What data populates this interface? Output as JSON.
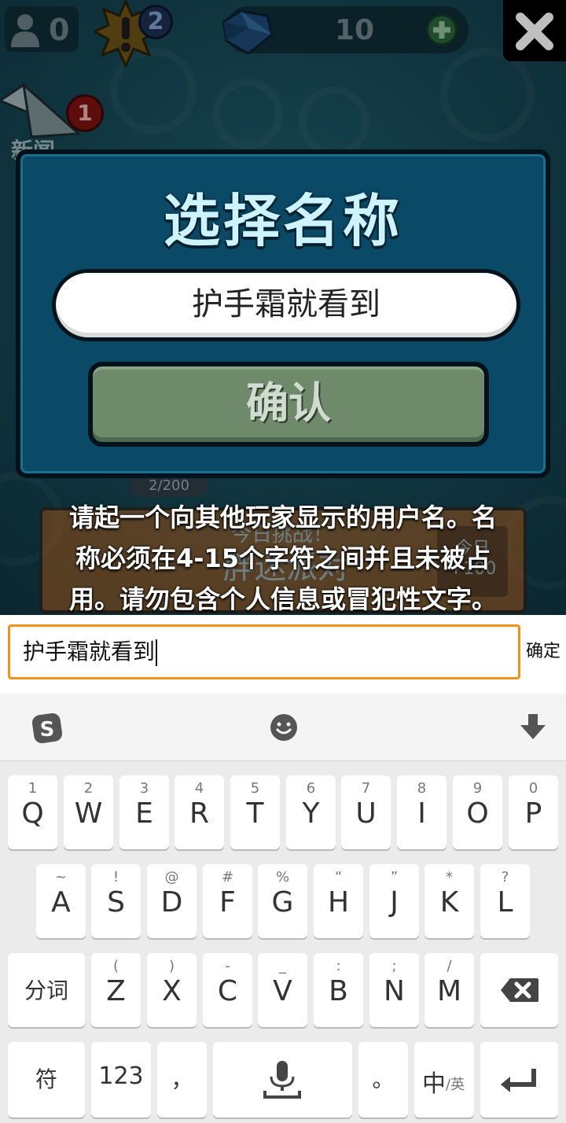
{
  "hud": {
    "players_count": "0",
    "alert_count": "2",
    "gems_count": "10"
  },
  "news": {
    "badge_count": "1",
    "label": "新闻"
  },
  "behind": {
    "progress": "2/200",
    "challenge_title": "今日挑战！",
    "challenge_name": "胖迷派对",
    "challenge_box": "今日 +100"
  },
  "modal": {
    "title": "选择名称",
    "name_value": "护手霜就看到",
    "confirm_label": "确认",
    "hint_lines": [
      "请起一个向其他玩家显示的用户名。名",
      "称必须在4-15个字符之间并且未被占",
      "用。请勿包含个人信息或冒犯性文字。"
    ]
  },
  "ime_bar": {
    "input_value": "护手霜就看到",
    "ok_label": "确定"
  },
  "keyboard": {
    "toolbar": [
      "sogou-logo-icon",
      "emoji-icon",
      "hide-keyboard-icon"
    ],
    "row1": [
      {
        "key": "Q",
        "sub": "1"
      },
      {
        "key": "W",
        "sub": "2"
      },
      {
        "key": "E",
        "sub": "3"
      },
      {
        "key": "R",
        "sub": "4"
      },
      {
        "key": "T",
        "sub": "5"
      },
      {
        "key": "Y",
        "sub": "6"
      },
      {
        "key": "U",
        "sub": "7"
      },
      {
        "key": "I",
        "sub": "8"
      },
      {
        "key": "O",
        "sub": "9"
      },
      {
        "key": "P",
        "sub": "0"
      }
    ],
    "row2": [
      {
        "key": "A",
        "sub": "~"
      },
      {
        "key": "S",
        "sub": "!"
      },
      {
        "key": "D",
        "sub": "@"
      },
      {
        "key": "F",
        "sub": "#"
      },
      {
        "key": "G",
        "sub": "%"
      },
      {
        "key": "H",
        "sub": "“"
      },
      {
        "key": "J",
        "sub": "”"
      },
      {
        "key": "K",
        "sub": "*"
      },
      {
        "key": "L",
        "sub": "?"
      }
    ],
    "row3": [
      {
        "key": "Z",
        "sub": "("
      },
      {
        "key": "X",
        "sub": ")"
      },
      {
        "key": "C",
        "sub": "-"
      },
      {
        "key": "V",
        "sub": "_"
      },
      {
        "key": "B",
        "sub": ":"
      },
      {
        "key": "N",
        "sub": ";"
      },
      {
        "key": "M",
        "sub": "/"
      }
    ],
    "split_label": "分词",
    "symbol_label": "符",
    "num_label": "123",
    "comma_label": "，",
    "period_label": "。",
    "lang_main": "中",
    "lang_sub": "/英"
  }
}
